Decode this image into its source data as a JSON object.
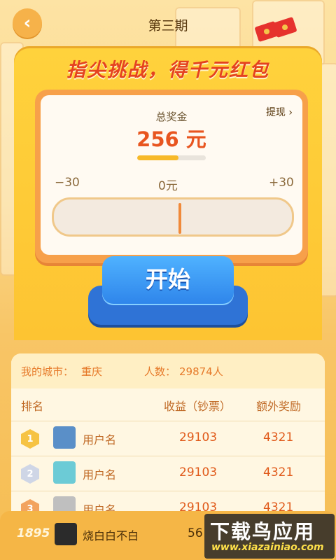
{
  "header": {
    "title": "第三期",
    "back_icon": "‹"
  },
  "machine": {
    "headline": "指尖挑战，得千元红包",
    "prize_label": "总奖金",
    "withdraw_label": "提现 ›",
    "prize_value": "256 元",
    "prize_progress": 0.6,
    "scale": {
      "left": "−30",
      "center": "0元",
      "right": "+30"
    },
    "start_label": "开始"
  },
  "ranking": {
    "city_label": "我的城市：",
    "city_value": "重庆",
    "people_label": "人数：",
    "people_value": "29874人",
    "columns": {
      "rank": "排名",
      "income": "收益（钞票）",
      "bonus": "额外奖励"
    },
    "rows": [
      {
        "rank": "1",
        "name": "用户名",
        "income": "29103",
        "bonus": "4321",
        "badge_color": "#f6c343",
        "avatar_color": "#5a8fc8"
      },
      {
        "rank": "2",
        "name": "用户名",
        "income": "29103",
        "bonus": "4321",
        "badge_color": "#cfd6e6",
        "avatar_color": "#6ccbd6"
      },
      {
        "rank": "3",
        "name": "用户名",
        "income": "29103",
        "bonus": "4321",
        "badge_color": "#f2a35e",
        "avatar_color": "#bfbfbf"
      }
    ]
  },
  "me": {
    "rank": "1895",
    "name": "烧白白不白",
    "income": "56"
  },
  "watermark": {
    "line1": "下载鸟应用",
    "line2": "www.xiazainiao.com"
  },
  "colors": {
    "accent": "#e8551f",
    "button": "#2e84ea",
    "machine": "#ffd23c"
  }
}
